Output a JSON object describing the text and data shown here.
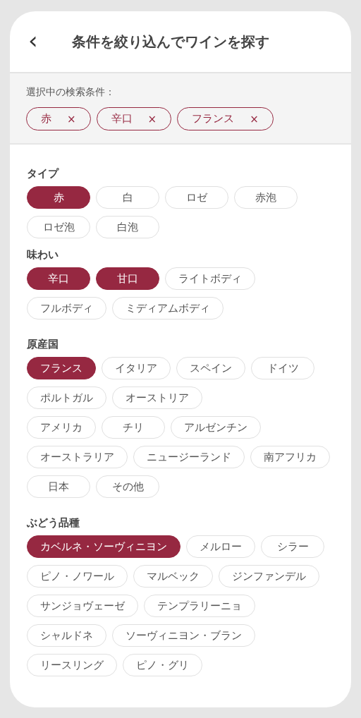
{
  "header": {
    "back": "‹",
    "title": "条件を絞り込んでワインを探す"
  },
  "selected_conditions": {
    "label": "選択中の検索条件：",
    "chips": [
      {
        "label": "赤",
        "remove": "×"
      },
      {
        "label": "辛口",
        "remove": "×"
      },
      {
        "label": "フランス",
        "remove": "×"
      }
    ]
  },
  "sections": [
    {
      "title": "タイプ",
      "option_rows": [
        [
          {
            "label": "赤",
            "selected": true
          },
          {
            "label": "白",
            "selected": false
          },
          {
            "label": "ロゼ",
            "selected": false
          },
          {
            "label": "赤泡",
            "selected": false
          }
        ],
        [
          {
            "label": "ロゼ泡",
            "selected": false
          },
          {
            "label": "白泡",
            "selected": false
          }
        ]
      ]
    },
    {
      "title": "味わい",
      "option_rows": [
        [
          {
            "label": "辛口",
            "selected": true
          },
          {
            "label": "甘口",
            "selected": true
          },
          {
            "label": "ライトボディ",
            "selected": false
          }
        ],
        [
          {
            "label": "フルボディ",
            "selected": false
          },
          {
            "label": "ミディアムボディ",
            "selected": false
          }
        ]
      ]
    },
    {
      "title": "原産国",
      "option_rows": [
        [
          {
            "label": "フランス",
            "selected": true
          },
          {
            "label": "イタリア",
            "selected": false
          },
          {
            "label": "スペイン",
            "selected": false
          },
          {
            "label": "ドイツ",
            "selected": false
          }
        ],
        [
          {
            "label": "ポルトガル",
            "selected": false
          },
          {
            "label": "オーストリア",
            "selected": false
          }
        ],
        [
          {
            "label": "アメリカ",
            "selected": false
          },
          {
            "label": "チリ",
            "selected": false
          },
          {
            "label": "アルゼンチン",
            "selected": false
          }
        ],
        [
          {
            "label": "オーストラリア",
            "selected": false
          },
          {
            "label": "ニュージーランド",
            "selected": false
          },
          {
            "label": "南アフリカ",
            "selected": false
          }
        ],
        [
          {
            "label": "日本",
            "selected": false
          },
          {
            "label": "その他",
            "selected": false
          }
        ]
      ]
    },
    {
      "title": "ぶどう品種",
      "option_rows": [
        [
          {
            "label": "カベルネ・ソーヴィニヨン",
            "selected": true
          },
          {
            "label": "メルロー",
            "selected": false
          },
          {
            "label": "シラー",
            "selected": false
          }
        ],
        [
          {
            "label": "ピノ・ノワール",
            "selected": false
          },
          {
            "label": "マルベック",
            "selected": false
          },
          {
            "label": "ジンファンデル",
            "selected": false
          }
        ],
        [
          {
            "label": "サンジョヴェーゼ",
            "selected": false
          },
          {
            "label": "テンプラリーニョ",
            "selected": false
          }
        ],
        [
          {
            "label": "シャルドネ",
            "selected": false
          },
          {
            "label": "ソーヴィニヨン・ブラン",
            "selected": false
          }
        ],
        [
          {
            "label": "リースリング",
            "selected": false
          },
          {
            "label": "ピノ・グリ",
            "selected": false
          }
        ]
      ]
    }
  ]
}
